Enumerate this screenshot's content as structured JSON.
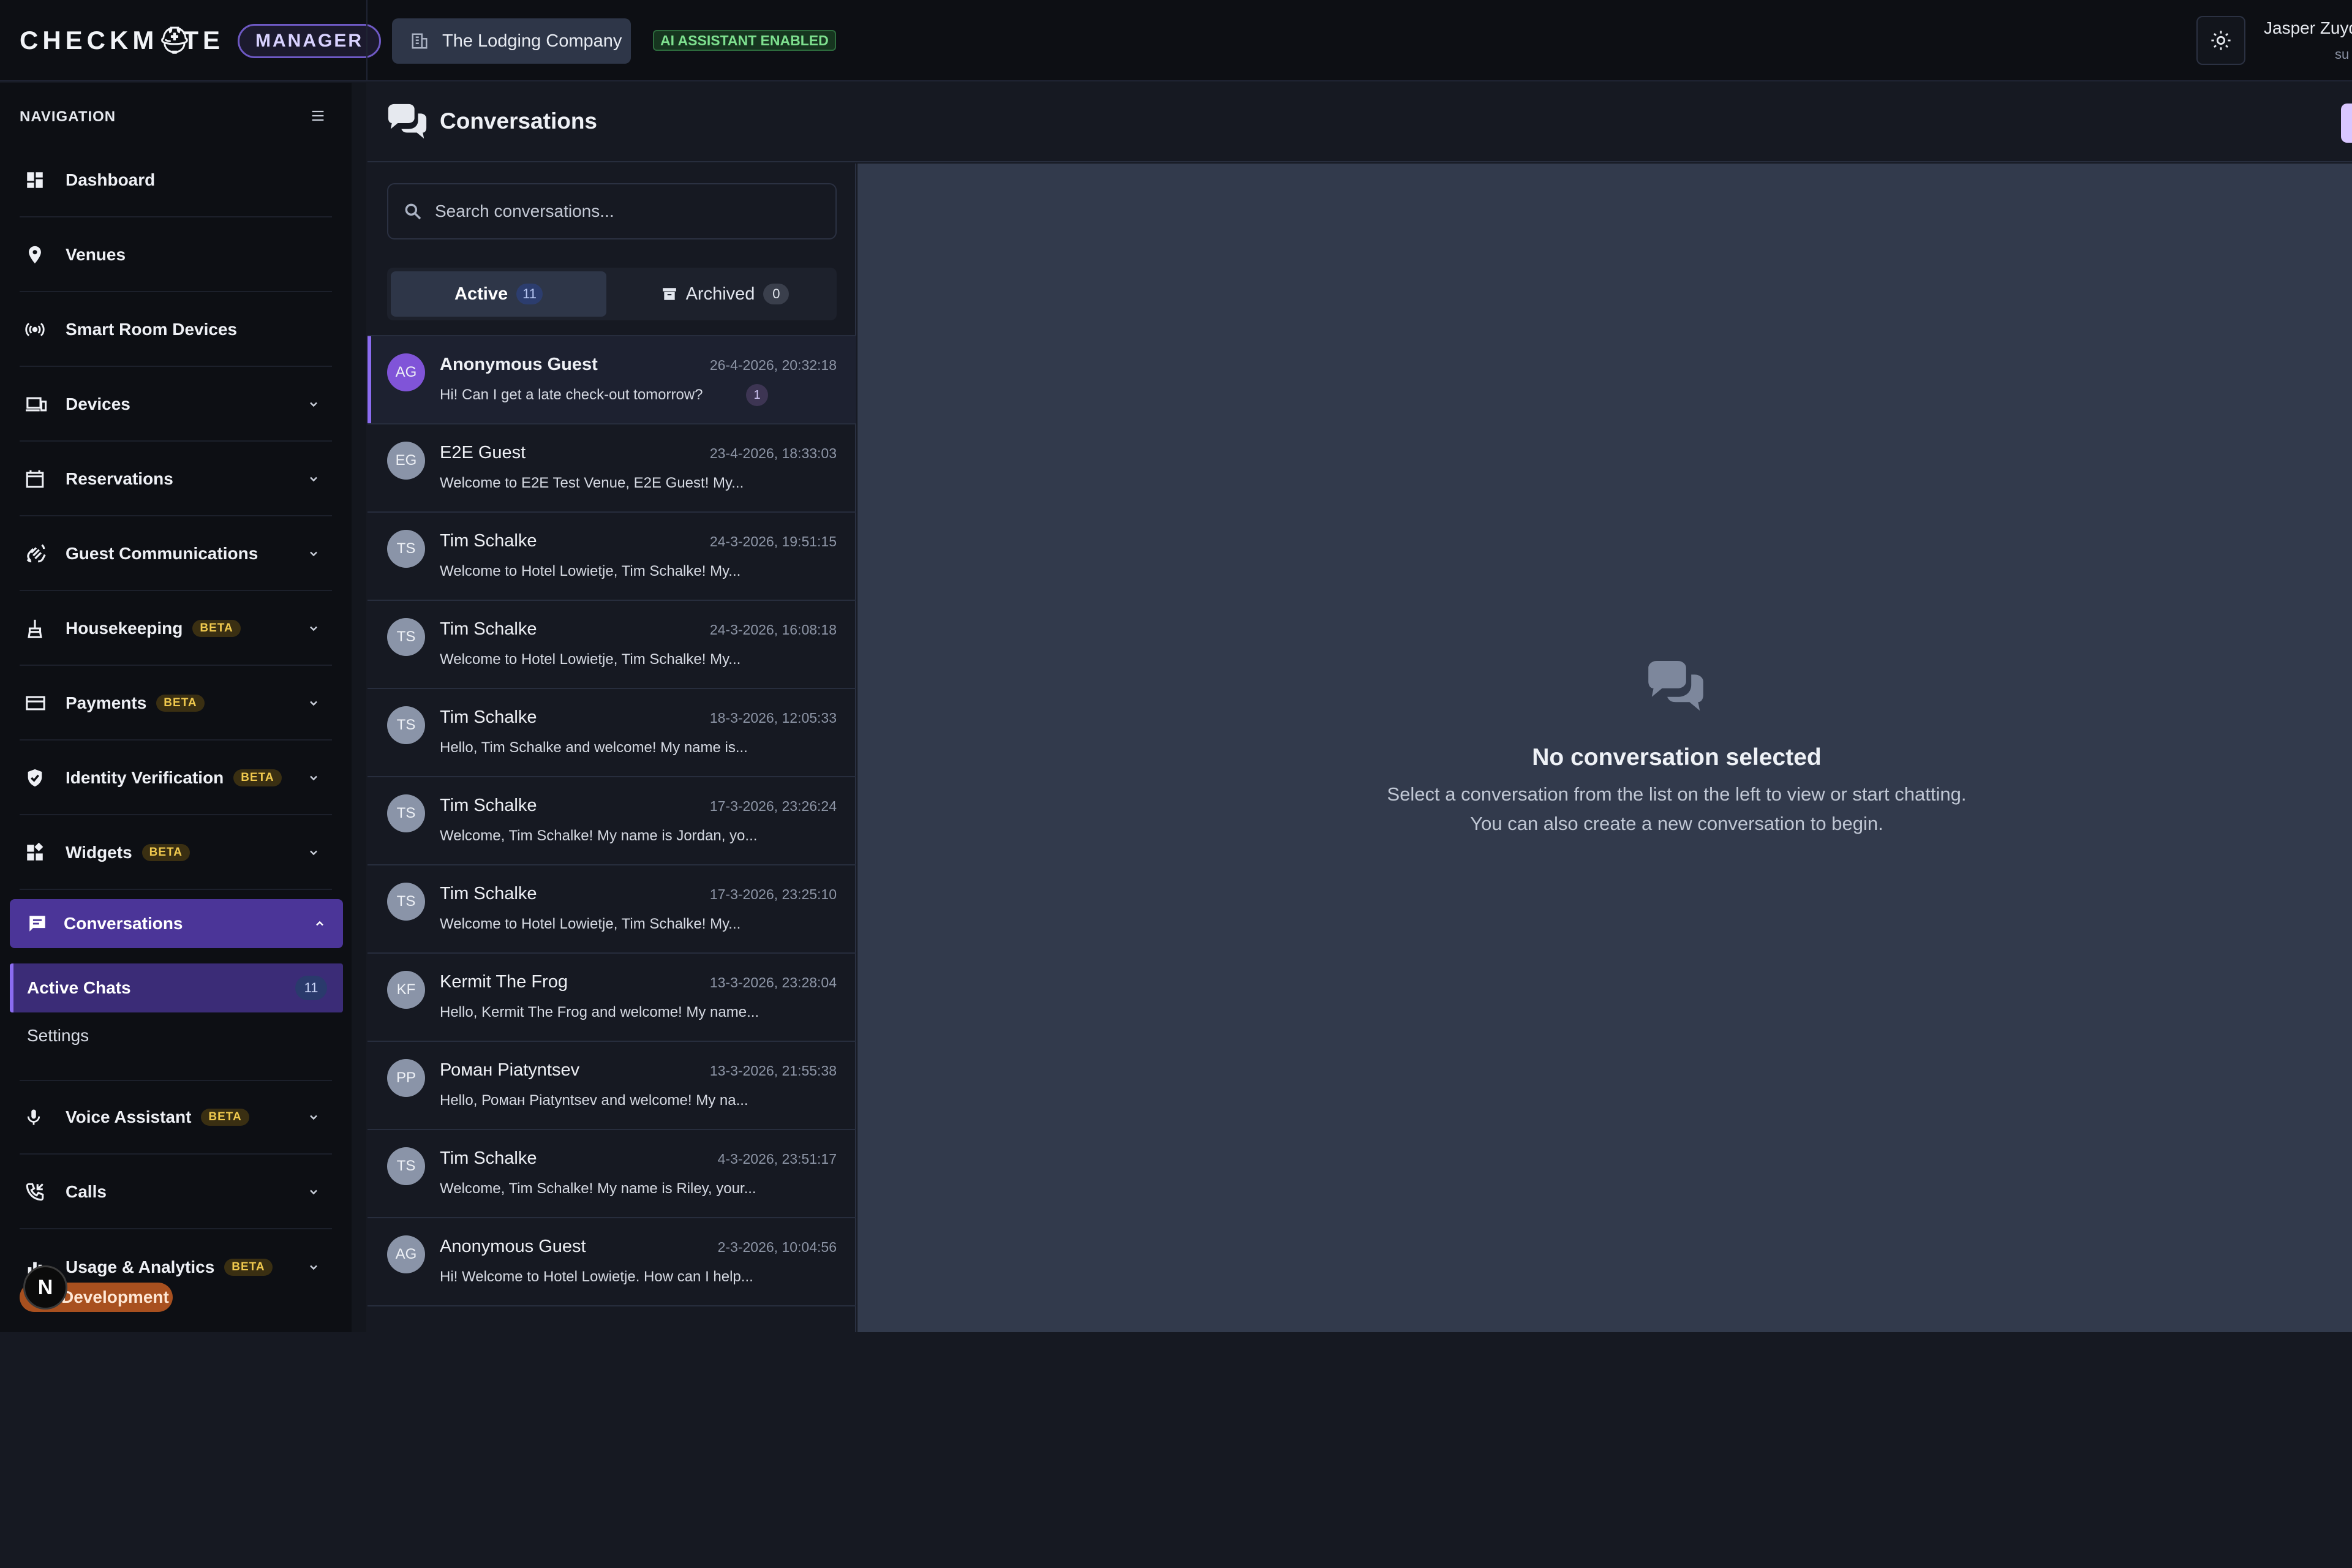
{
  "brand": {
    "name_left": "CHECKM",
    "name_hat": "⛑",
    "name_right": "TE",
    "tier": "MANAGER"
  },
  "topbar": {
    "organization": "The Lodging Company",
    "ai_badge": "AI ASSISTANT ENABLED",
    "user_name": "Jasper Zuyd",
    "user_role": "su"
  },
  "sidebar": {
    "header": "NAVIGATION",
    "items": [
      {
        "label": "Dashboard",
        "icon": "dashboard-icon",
        "beta": "",
        "expandable": false
      },
      {
        "label": "Venues",
        "icon": "location-pin-icon",
        "beta": "",
        "expandable": false
      },
      {
        "label": "Smart Room Devices",
        "icon": "broadcast-icon",
        "beta": "",
        "expandable": false
      },
      {
        "label": "Devices",
        "icon": "devices-icon",
        "beta": "",
        "expandable": true
      },
      {
        "label": "Reservations",
        "icon": "calendar-icon",
        "beta": "",
        "expandable": true
      },
      {
        "label": "Guest Communications",
        "icon": "waving-hand-icon",
        "beta": "",
        "expandable": true
      },
      {
        "label": "Housekeeping",
        "icon": "broom-icon",
        "beta": "BETA",
        "expandable": true
      },
      {
        "label": "Payments",
        "icon": "credit-card-icon",
        "beta": "BETA",
        "expandable": true
      },
      {
        "label": "Identity Verification",
        "icon": "shield-check-icon",
        "beta": "BETA",
        "expandable": true
      },
      {
        "label": "Widgets",
        "icon": "widgets-icon",
        "beta": "BETA",
        "expandable": true
      }
    ],
    "active_section": {
      "label": "Conversations",
      "icon": "chat-icon"
    },
    "active_sub": {
      "label": "Active Chats",
      "count": "11"
    },
    "sub_item": "Settings",
    "items_after": [
      {
        "label": "Voice Assistant",
        "icon": "microphone-icon",
        "beta": "BETA"
      },
      {
        "label": "Calls",
        "icon": "phone-icon",
        "beta": ""
      },
      {
        "label": "Usage & Analytics",
        "icon": "analytics-icon",
        "beta": "BETA"
      }
    ],
    "dev_badge": "Development",
    "dev_letter": "N"
  },
  "main": {
    "title": "Conversations",
    "search_placeholder": "Search conversations...",
    "tabs": [
      {
        "label": "Active",
        "count": "11"
      },
      {
        "label": "Archived",
        "count": "0"
      }
    ]
  },
  "conversations": [
    {
      "initials": "AG",
      "name": "Anonymous Guest",
      "time": "26-4-2026, 20:32:18",
      "message": "Hi! Can I get a late check-out tomorrow?",
      "unread": "1"
    },
    {
      "initials": "EG",
      "name": "E2E Guest",
      "time": "23-4-2026, 18:33:03",
      "message": "Welcome to E2E Test Venue, E2E Guest! My...",
      "unread": ""
    },
    {
      "initials": "TS",
      "name": "Tim Schalke",
      "time": "24-3-2026, 19:51:15",
      "message": "Welcome to Hotel Lowietje, Tim Schalke! My...",
      "unread": ""
    },
    {
      "initials": "TS",
      "name": "Tim Schalke",
      "time": "24-3-2026, 16:08:18",
      "message": "Welcome to Hotel Lowietje, Tim Schalke! My...",
      "unread": ""
    },
    {
      "initials": "TS",
      "name": "Tim Schalke",
      "time": "18-3-2026, 12:05:33",
      "message": "Hello, Tim Schalke and welcome! My name is...",
      "unread": ""
    },
    {
      "initials": "TS",
      "name": "Tim Schalke",
      "time": "17-3-2026, 23:26:24",
      "message": "Welcome, Tim Schalke! My name is Jordan, yo...",
      "unread": ""
    },
    {
      "initials": "TS",
      "name": "Tim Schalke",
      "time": "17-3-2026, 23:25:10",
      "message": "Welcome to Hotel Lowietje, Tim Schalke! My...",
      "unread": ""
    },
    {
      "initials": "KF",
      "name": "Kermit The Frog",
      "time": "13-3-2026, 23:28:04",
      "message": "Hello, Kermit The Frog and welcome! My name...",
      "unread": ""
    },
    {
      "initials": "PP",
      "name": "Роман Piatyntsev",
      "time": "13-3-2026, 21:55:38",
      "message": "Hello, Роман Piatyntsev and welcome! My na...",
      "unread": ""
    },
    {
      "initials": "TS",
      "name": "Tim Schalke",
      "time": "4-3-2026, 23:51:17",
      "message": "Welcome, Tim Schalke! My name is Riley, your...",
      "unread": ""
    },
    {
      "initials": "AG",
      "name": "Anonymous Guest",
      "time": "2-3-2026, 10:04:56",
      "message": "Hi! Welcome to Hotel Lowietje. How can I help...",
      "unread": ""
    }
  ],
  "empty_state": {
    "title": "No conversation selected",
    "line1": "Select a conversation from the list on the left to view or start chatting.",
    "line2": "You can also create a new conversation to begin."
  },
  "colors": {
    "accent": "#8b6cf0",
    "active_nav": "#4b3598",
    "beta_text": "#f0c94e",
    "ai_badge": "#7ee08f"
  }
}
